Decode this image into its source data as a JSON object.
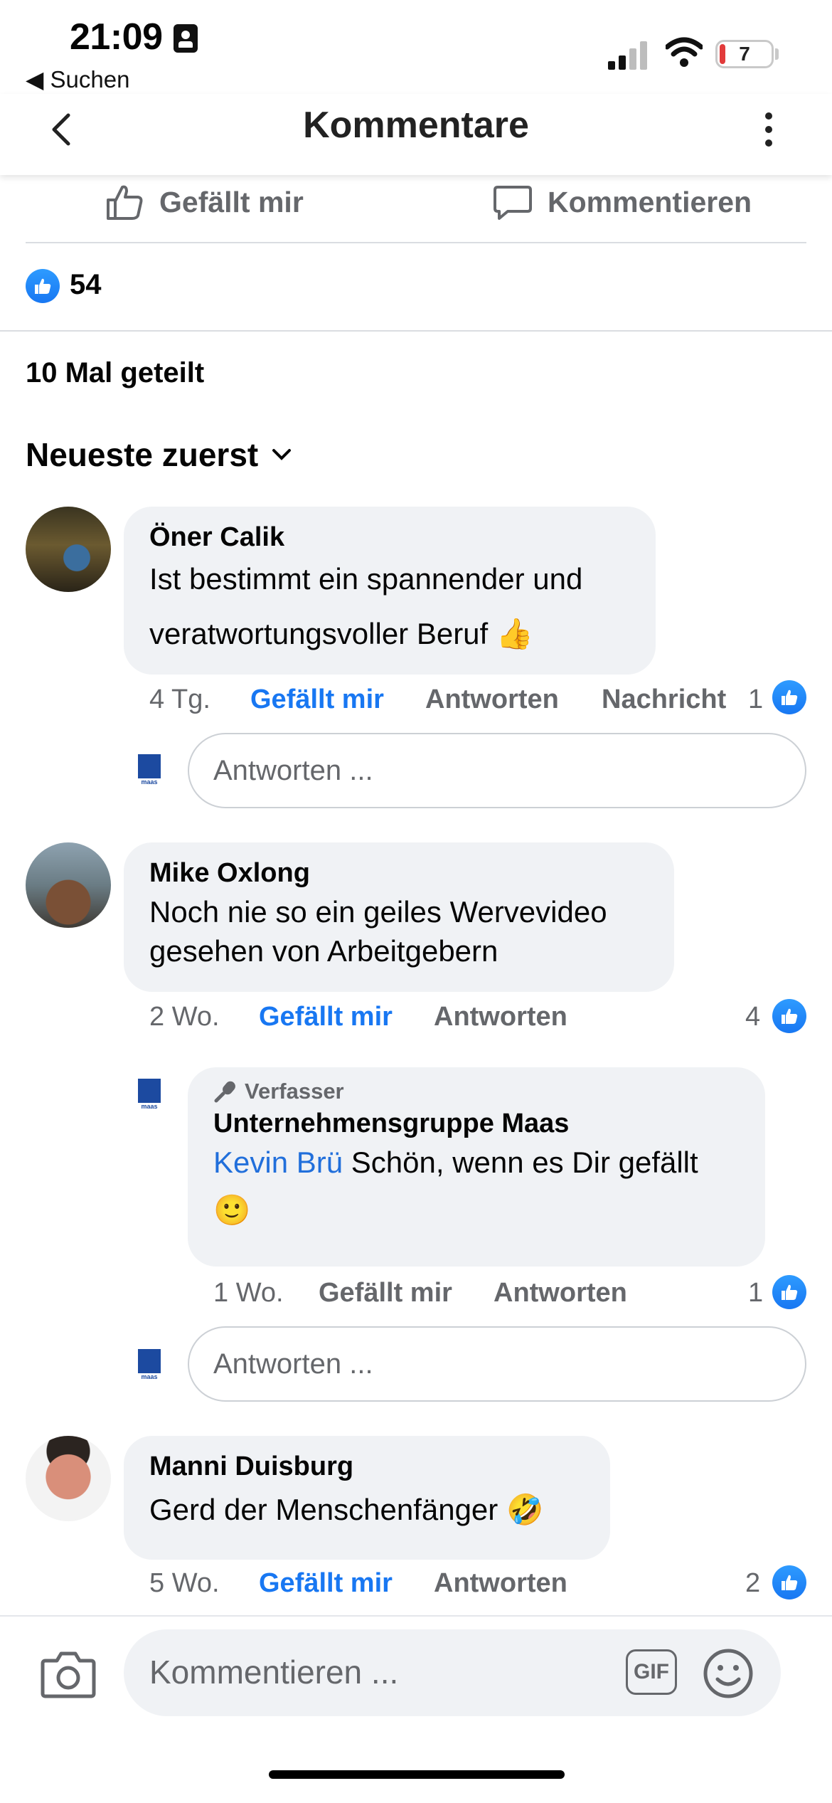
{
  "status_bar": {
    "time": "21:09",
    "back_app": "◀ Suchen",
    "battery": "7"
  },
  "nav": {
    "title": "Kommentare"
  },
  "actions": {
    "like": "Gefällt mir",
    "comment": "Kommentieren"
  },
  "post_stats": {
    "likes": "54",
    "shares": "10 Mal geteilt"
  },
  "sort": {
    "label": "Neueste zuerst"
  },
  "comments": [
    {
      "author": "Öner Calik",
      "text_line1": "Ist bestimmt ein spannender und",
      "text_line2": "veratwortungsvoller   Beruf 👍",
      "time": "4 Tg.",
      "like": "Gefällt mir",
      "reply": "Antworten",
      "message": "Nachricht",
      "reactions": "1"
    },
    {
      "author": "Mike Oxlong",
      "text_line1": "Noch nie so ein geiles Wervevideo",
      "text_line2": "gesehen von Arbeitgebern",
      "time": "2 Wo.",
      "like": "Gefällt mir",
      "reply": "Antworten",
      "reactions": "4",
      "reply_item": {
        "badge": "Verfasser",
        "author": "Unternehmensgruppe Maas",
        "mention": "Kevin Brü",
        "text_line1": " Schön, wenn es Dir gefällt",
        "text_line2": "🙂",
        "time": "1 Wo.",
        "like": "Gefällt mir",
        "reply": "Antworten",
        "reactions": "1"
      }
    },
    {
      "author": "Manni Duisburg",
      "text": "Gerd der Menschenfänger 🤣",
      "time": "5 Wo.",
      "like": "Gefällt mir",
      "reply": "Antworten",
      "reactions": "2"
    }
  ],
  "reply_placeholder": "Antworten ...",
  "composer": {
    "placeholder": "Kommentieren ...",
    "gif": "GIF"
  },
  "colors": {
    "accent": "#1877f2",
    "bubble": "#f0f2f5",
    "muted": "#65676b",
    "maas_blue": "#1c4aa0"
  }
}
